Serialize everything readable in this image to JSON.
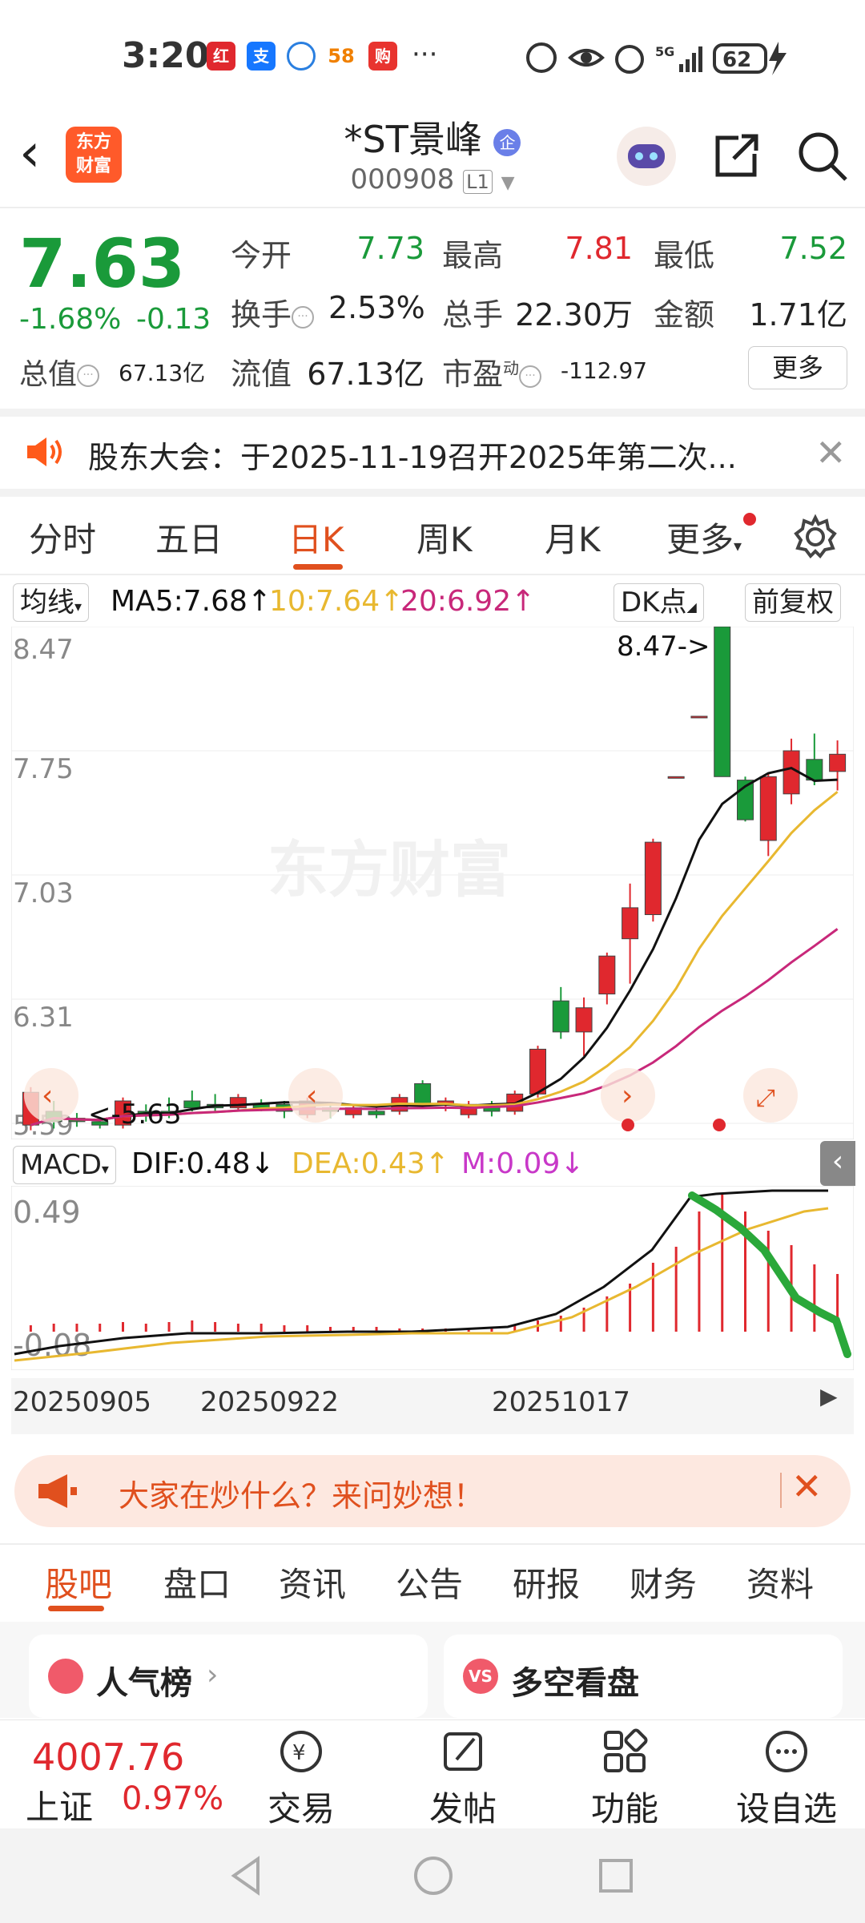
{
  "status_bar": {
    "time": "3:20",
    "battery": "62",
    "network": "5G"
  },
  "header": {
    "logo_text_1": "东方",
    "logo_text_2": "财富",
    "stock_name": "*ST景峰",
    "stock_code": "000908",
    "level_badge": "L1"
  },
  "quote": {
    "price": "7.63",
    "change_pct": "-1.68%",
    "change": "-0.13",
    "open_label": "今开",
    "open": "7.73",
    "high_label": "最高",
    "high": "7.81",
    "low_label": "最低",
    "low": "7.52",
    "turnover_label": "换手",
    "turnover": "2.53%",
    "volume_label": "总手",
    "volume": "22.30万",
    "amount_label": "金额",
    "amount": "1.71亿",
    "mktcap_label": "总值",
    "mktcap": "67.13亿",
    "float_label": "流值",
    "float_cap": "67.13亿",
    "pe_label": "市盈",
    "pe_sup": "动",
    "pe": "-112.97",
    "more_button": "更多"
  },
  "notice": {
    "text": "股东大会：于2025-11-19召开2025年第二次..."
  },
  "period_tabs": [
    "分时",
    "五日",
    "日K",
    "周K",
    "月K",
    "更多"
  ],
  "ma_bar": {
    "type_chip": "均线",
    "ma5": "MA5:7.68",
    "ma10": "10:7.64",
    "ma20": "20:6.92",
    "dk_chip": "DK点",
    "adjust_chip": "前复权"
  },
  "chart_data": {
    "type": "candlestick",
    "y_ticks": [
      "8.47",
      "7.75",
      "7.03",
      "6.31",
      "5.59"
    ],
    "ylim": [
      5.59,
      8.47
    ],
    "max_label": "8.47->",
    "min_label": "<-5.63",
    "candles": [
      {
        "o": 5.77,
        "c": 5.58,
        "h": 5.8,
        "l": 5.55,
        "color": "red"
      },
      {
        "o": 5.6,
        "c": 5.66,
        "h": 5.72,
        "l": 5.56,
        "color": "green"
      },
      {
        "o": 5.62,
        "c": 5.6,
        "h": 5.65,
        "l": 5.57,
        "color": "green"
      },
      {
        "o": 5.58,
        "c": 5.6,
        "h": 5.61,
        "l": 5.56,
        "color": "green"
      },
      {
        "o": 5.58,
        "c": 5.72,
        "h": 5.74,
        "l": 5.56,
        "color": "red"
      },
      {
        "o": 5.64,
        "c": 5.66,
        "h": 5.7,
        "l": 5.6,
        "color": "green"
      },
      {
        "o": 5.64,
        "c": 5.66,
        "h": 5.74,
        "l": 5.62,
        "color": "green"
      },
      {
        "o": 5.68,
        "c": 5.72,
        "h": 5.78,
        "l": 5.66,
        "color": "green"
      },
      {
        "o": 5.68,
        "c": 5.7,
        "h": 5.76,
        "l": 5.66,
        "color": "green"
      },
      {
        "o": 5.68,
        "c": 5.74,
        "h": 5.76,
        "l": 5.66,
        "color": "red"
      },
      {
        "o": 5.68,
        "c": 5.7,
        "h": 5.73,
        "l": 5.66,
        "color": "green"
      },
      {
        "o": 5.66,
        "c": 5.7,
        "h": 5.72,
        "l": 5.62,
        "color": "green"
      },
      {
        "o": 5.64,
        "c": 5.72,
        "h": 5.74,
        "l": 5.62,
        "color": "red"
      },
      {
        "o": 5.66,
        "c": 5.68,
        "h": 5.7,
        "l": 5.62,
        "color": "green"
      },
      {
        "o": 5.64,
        "c": 5.68,
        "h": 5.7,
        "l": 5.62,
        "color": "red"
      },
      {
        "o": 5.64,
        "c": 5.66,
        "h": 5.7,
        "l": 5.62,
        "color": "green"
      },
      {
        "o": 5.66,
        "c": 5.74,
        "h": 5.76,
        "l": 5.64,
        "color": "red"
      },
      {
        "o": 5.82,
        "c": 5.7,
        "h": 5.84,
        "l": 5.68,
        "color": "green"
      },
      {
        "o": 5.7,
        "c": 5.72,
        "h": 5.74,
        "l": 5.66,
        "color": "red"
      },
      {
        "o": 5.7,
        "c": 5.64,
        "h": 5.72,
        "l": 5.62,
        "color": "red"
      },
      {
        "o": 5.66,
        "c": 5.7,
        "h": 5.72,
        "l": 5.63,
        "color": "green"
      },
      {
        "o": 5.66,
        "c": 5.76,
        "h": 5.78,
        "l": 5.64,
        "color": "red"
      },
      {
        "o": 5.76,
        "c": 6.02,
        "h": 6.04,
        "l": 5.74,
        "color": "red"
      },
      {
        "o": 6.3,
        "c": 6.12,
        "h": 6.38,
        "l": 6.08,
        "color": "green"
      },
      {
        "o": 6.12,
        "c": 6.26,
        "h": 6.32,
        "l": 5.98,
        "color": "red"
      },
      {
        "o": 6.34,
        "c": 6.56,
        "h": 6.58,
        "l": 6.28,
        "color": "red"
      },
      {
        "o": 6.66,
        "c": 6.84,
        "h": 6.98,
        "l": 6.4,
        "color": "red"
      },
      {
        "o": 6.8,
        "c": 7.22,
        "h": 7.24,
        "l": 6.76,
        "color": "red"
      },
      {
        "o": 7.6,
        "c": 7.6,
        "h": 7.6,
        "l": 7.6,
        "color": "red"
      },
      {
        "o": 7.95,
        "c": 7.95,
        "h": 7.95,
        "l": 7.95,
        "color": "red"
      },
      {
        "o": 8.47,
        "c": 7.6,
        "h": 8.47,
        "l": 7.6,
        "color": "green"
      },
      {
        "o": 7.58,
        "c": 7.35,
        "h": 7.6,
        "l": 7.34,
        "color": "green"
      },
      {
        "o": 7.23,
        "c": 7.6,
        "h": 7.62,
        "l": 7.14,
        "color": "red"
      },
      {
        "o": 7.5,
        "c": 7.75,
        "h": 7.82,
        "l": 7.44,
        "color": "red"
      },
      {
        "o": 7.7,
        "c": 7.58,
        "h": 7.85,
        "l": 7.55,
        "color": "green"
      },
      {
        "o": 7.73,
        "c": 7.63,
        "h": 7.81,
        "l": 7.52,
        "color": "red"
      }
    ]
  },
  "macd": {
    "type_chip": "MACD",
    "dif": "DIF:0.48",
    "dea": "DEA:0.43",
    "m": "M:0.09",
    "y_ticks": [
      "0.49",
      "-0.08"
    ]
  },
  "dates": [
    "20250905",
    "20250922",
    "20251017"
  ],
  "banner": {
    "text": "大家在炒什么？来问妙想！"
  },
  "bottom_tabs": [
    "股吧",
    "盘口",
    "资讯",
    "公告",
    "研报",
    "财务",
    "资料"
  ],
  "cards": {
    "left_title": "人气榜",
    "right_title": "多空看盘"
  },
  "bottom_nav": {
    "index_value": "4007.76",
    "index_name": "上证",
    "index_pct": "0.97%",
    "items": [
      "交易",
      "发帖",
      "功能",
      "设自选"
    ]
  },
  "colors": {
    "up": "#e0282e",
    "down": "#1a9a3a",
    "accent": "#e0501e",
    "ma5": "#111111",
    "ma10": "#e8b830",
    "ma20": "#c8287a"
  }
}
